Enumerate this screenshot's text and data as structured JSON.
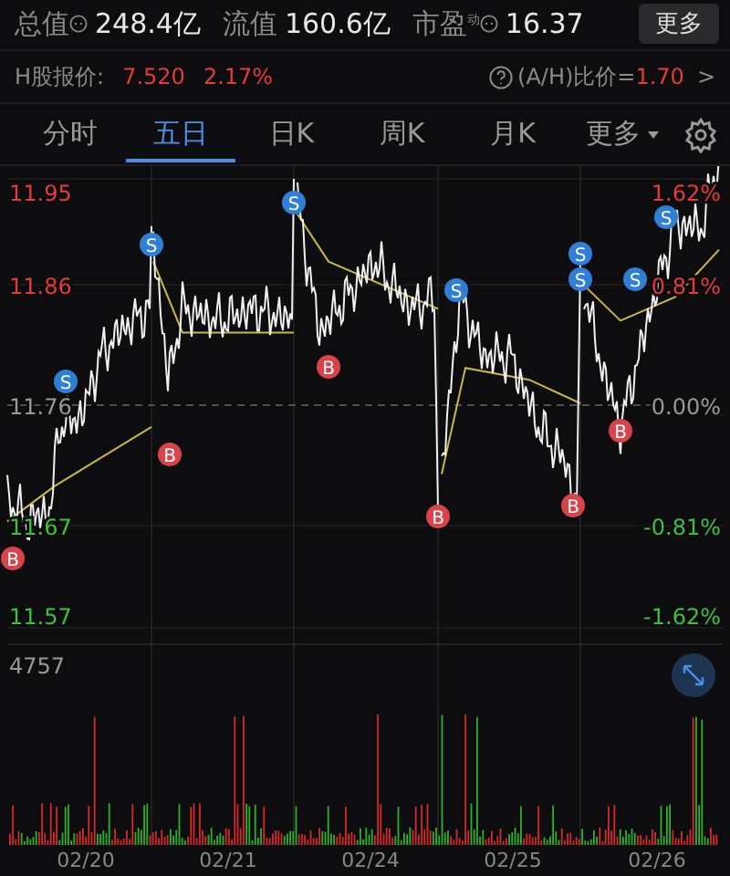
{
  "stats": [
    {
      "label": "总值",
      "icon": true,
      "value": "248.4亿"
    },
    {
      "label": "流值",
      "icon": false,
      "value": "160.6亿"
    },
    {
      "label": "市盈",
      "icon": true,
      "sup": "动",
      "value": "16.37"
    }
  ],
  "more_button": "更多",
  "h_share": {
    "label": "H股报价:",
    "price": "7.520",
    "change": "2.17%",
    "ratio_label": "(A/H)比价=",
    "ratio": "1.70",
    "arrow": ">"
  },
  "tabs": [
    {
      "label": "分时",
      "selected": false
    },
    {
      "label": "五日",
      "selected": true
    },
    {
      "label": "日K",
      "selected": false
    },
    {
      "label": "周K",
      "selected": false
    },
    {
      "label": "月K",
      "selected": false
    },
    {
      "label": "更多",
      "selected": false,
      "dropdown": true
    }
  ],
  "chart": {
    "price_labels": [
      "11.95",
      "11.86",
      "11.76",
      "11.67",
      "11.57"
    ],
    "percent_labels": [
      "1.62%",
      "0.81%",
      "0.00%",
      "-0.81%",
      "-1.62%"
    ],
    "markers": [
      {
        "kind": "buy",
        "label": "B"
      },
      {
        "kind": "sell",
        "label": "S"
      },
      {
        "kind": "sell",
        "label": "S"
      },
      {
        "kind": "buy",
        "label": "B"
      },
      {
        "kind": "sell",
        "label": "S"
      },
      {
        "kind": "buy",
        "label": "B"
      },
      {
        "kind": "buy",
        "label": "B"
      },
      {
        "kind": "sell",
        "label": "S"
      },
      {
        "kind": "sell",
        "label": "S"
      },
      {
        "kind": "sell",
        "label": "S"
      },
      {
        "kind": "buy",
        "label": "B"
      },
      {
        "kind": "buy",
        "label": "B"
      },
      {
        "kind": "sell",
        "label": "S"
      },
      {
        "kind": "sell",
        "label": "S"
      }
    ],
    "volume_label": "4757",
    "dates": [
      "02/20",
      "02/21",
      "02/24",
      "02/25",
      "02/26"
    ]
  }
}
